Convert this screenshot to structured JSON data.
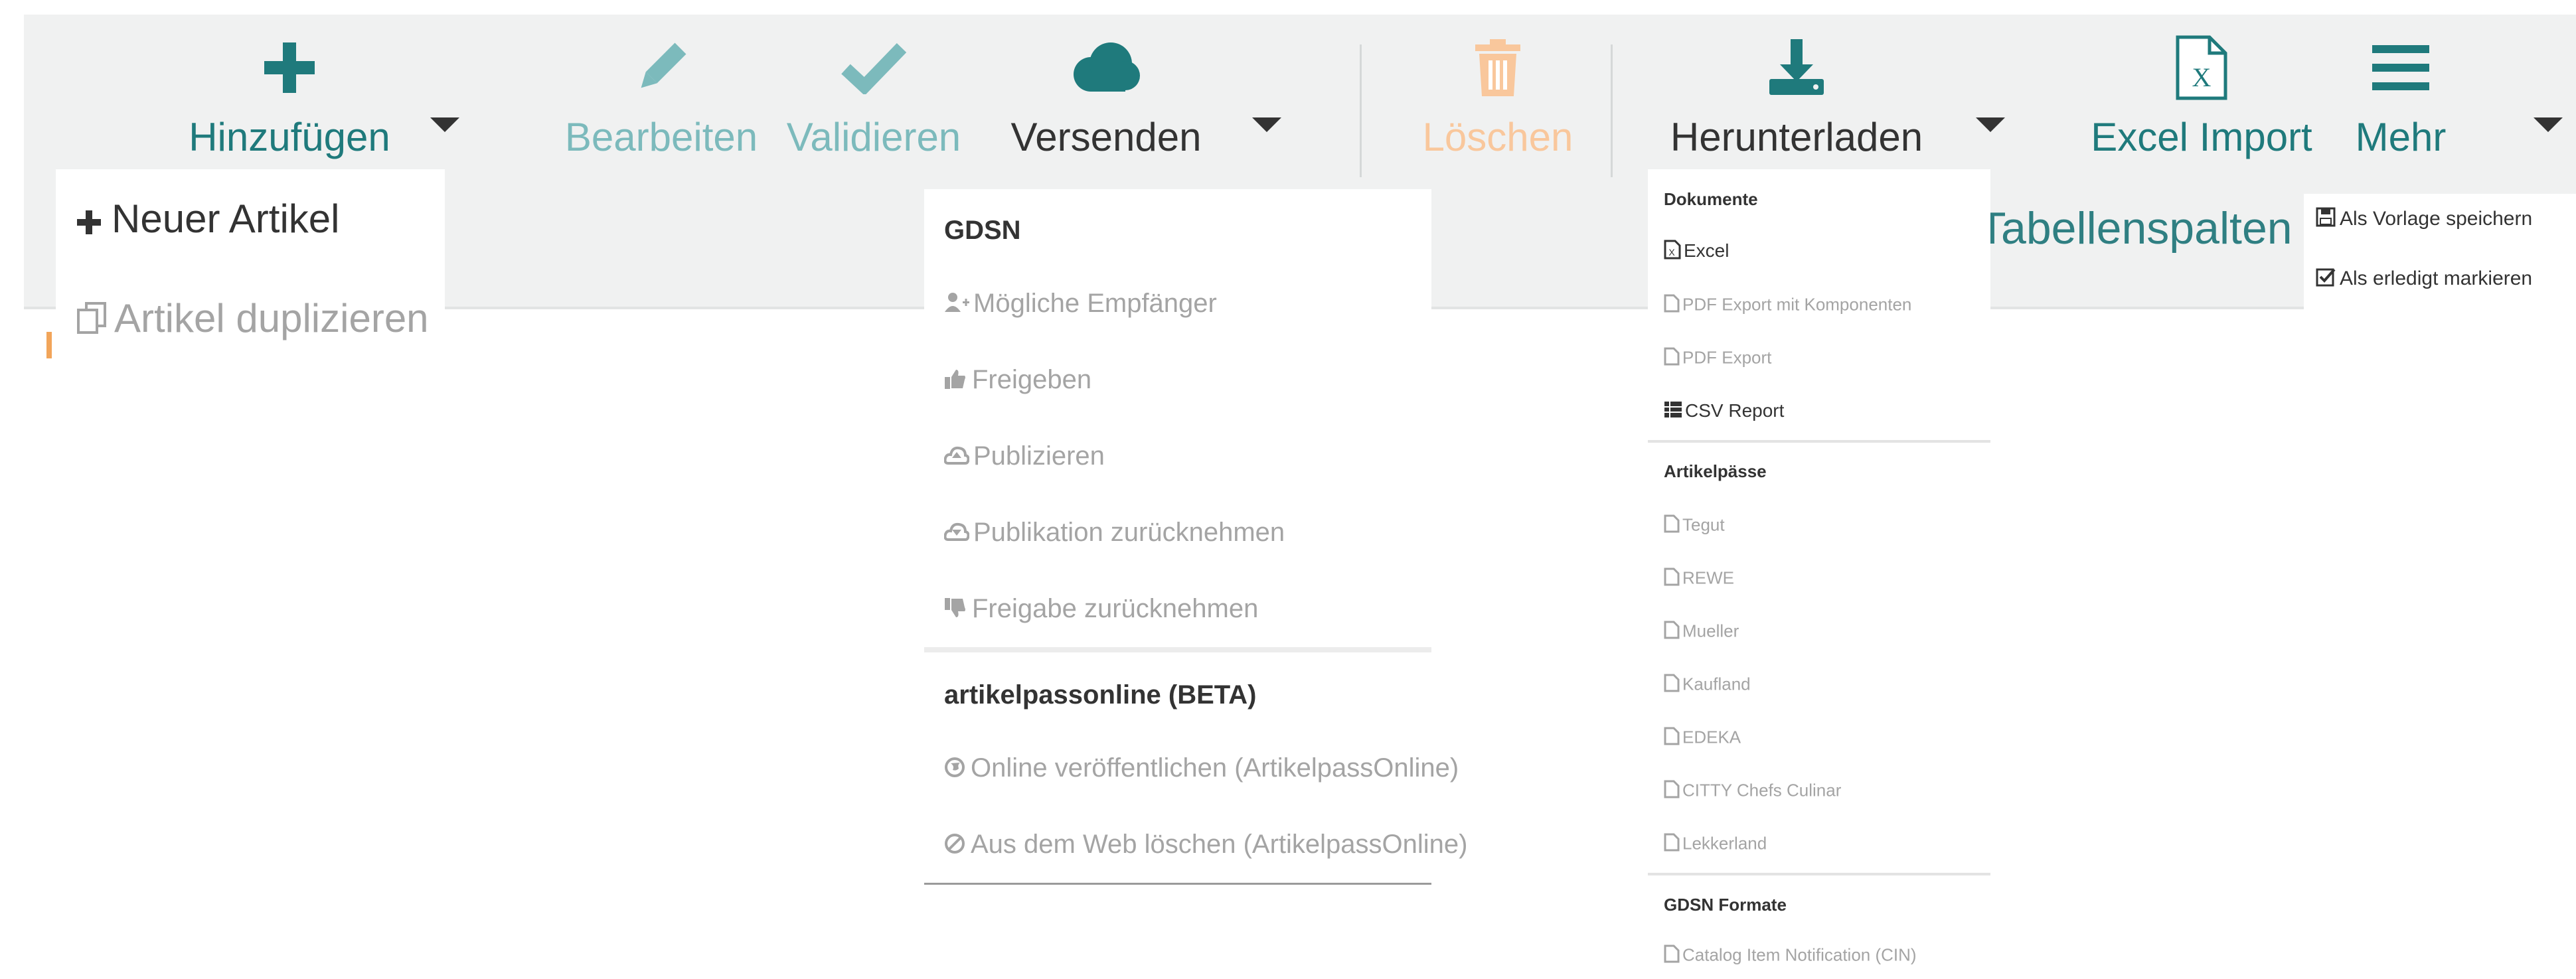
{
  "colors": {
    "teal_dark": "#1f7a7c",
    "teal_light": "#7cbabc",
    "orange_light": "#f9c79c",
    "gray_text": "#a4a4a4",
    "dark_text": "#333333"
  },
  "toolbar": {
    "add": {
      "label": "Hinzufügen",
      "icon": "plus-icon"
    },
    "edit": {
      "label": "Bearbeiten",
      "icon": "pencil-icon"
    },
    "validate": {
      "label": "Validieren",
      "icon": "checkmark-icon"
    },
    "send": {
      "label": "Versenden",
      "icon": "cloud-icon"
    },
    "delete": {
      "label": "Löschen",
      "icon": "trash-icon"
    },
    "download": {
      "label": "Herunterladen",
      "icon": "download-icon"
    },
    "excel_import": {
      "label": "Excel Import",
      "icon": "excel-icon"
    },
    "more": {
      "label": "Mehr",
      "icon": "menu-icon"
    }
  },
  "background_text": "Tabellenspalten",
  "add_menu": {
    "items": [
      {
        "label": "Neuer Artikel",
        "icon": "plus-icon"
      },
      {
        "label": "Artikel duplizieren",
        "icon": "copy-icon"
      }
    ]
  },
  "send_menu": {
    "gdsn_header": "GDSN",
    "gdsn_items": [
      {
        "label": "Mögliche Empfänger",
        "icon": "users-icon"
      },
      {
        "label": "Freigeben",
        "icon": "thumbs-up-icon"
      },
      {
        "label": "Publizieren",
        "icon": "cloud-up-icon"
      },
      {
        "label": "Publikation zurücknehmen",
        "icon": "cloud-down-icon"
      },
      {
        "label": "Freigabe zurücknehmen",
        "icon": "thumbs-down-icon"
      }
    ],
    "online_header": "artikelpassonline (BETA)",
    "online_items": [
      {
        "label": "Online veröffentlichen (ArtikelpassOnline)",
        "icon": "globe-icon"
      },
      {
        "label": "Aus dem Web löschen (ArtikelpassOnline)",
        "icon": "ban-icon"
      }
    ]
  },
  "download_menu": {
    "documents_header": "Dokumente",
    "documents": [
      {
        "label": "Excel",
        "icon": "file-excel-icon",
        "enabled": true
      },
      {
        "label": "PDF Export mit Komponenten",
        "icon": "file-icon",
        "enabled": false
      },
      {
        "label": "PDF Export",
        "icon": "file-icon",
        "enabled": false
      },
      {
        "label": "CSV Report",
        "icon": "table-icon",
        "enabled": true
      }
    ],
    "passes_header": "Artikelpässe",
    "passes": [
      {
        "label": "Tegut",
        "icon": "file-icon"
      },
      {
        "label": "REWE",
        "icon": "file-icon"
      },
      {
        "label": "Mueller",
        "icon": "file-icon"
      },
      {
        "label": "Kaufland",
        "icon": "file-icon"
      },
      {
        "label": "EDEKA",
        "icon": "file-icon"
      },
      {
        "label": "CITTY Chefs Culinar",
        "icon": "file-icon"
      },
      {
        "label": "Lekkerland",
        "icon": "file-icon"
      }
    ],
    "gdsn_header": "GDSN Formate",
    "gdsn": [
      {
        "label": "Catalog Item Notification (CIN)",
        "icon": "file-icon"
      }
    ]
  },
  "more_menu": {
    "items": [
      {
        "label": "Als Vorlage speichern",
        "icon": "save-icon"
      },
      {
        "label": "Als erledigt markieren",
        "icon": "check-square-icon"
      }
    ]
  }
}
